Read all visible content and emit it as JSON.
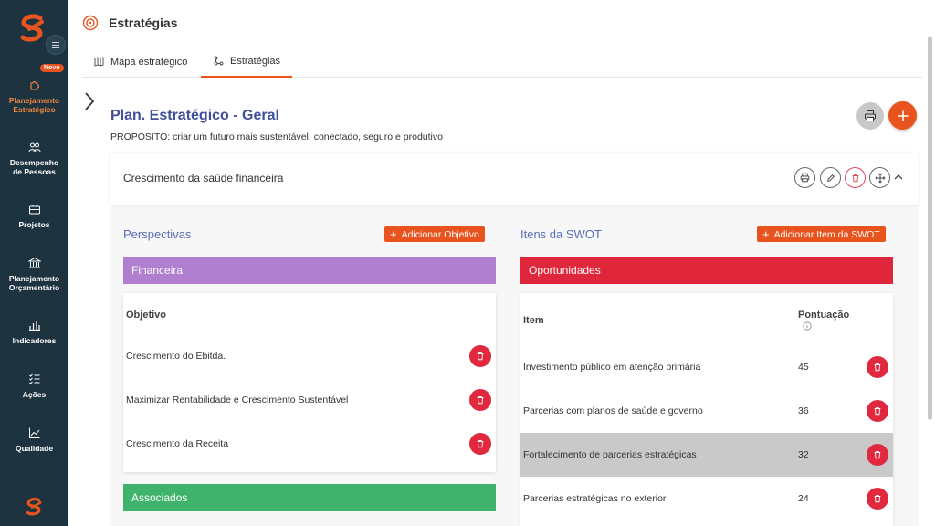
{
  "sidebar": {
    "badge": "Novo",
    "items": [
      {
        "line1": "Planejamento",
        "line2": "Estratégico",
        "icon": "puzzle-icon"
      },
      {
        "line1": "Desempenho",
        "line2": "de Pessoas",
        "icon": "people-icon"
      },
      {
        "line1": "Projetos",
        "line2": "",
        "icon": "briefcase-icon"
      },
      {
        "line1": "Planejamento",
        "line2": "Orçamentário",
        "icon": "bank-icon"
      },
      {
        "line1": "Indicadores",
        "line2": "",
        "icon": "bar-chart-icon"
      },
      {
        "line1": "Ações",
        "line2": "",
        "icon": "checklist-icon"
      },
      {
        "line1": "Qualidade",
        "line2": "",
        "icon": "line-chart-icon"
      }
    ],
    "accent": "#f0883e"
  },
  "header": {
    "title": "Estratégias",
    "tabs": [
      {
        "label": "Mapa estratégico",
        "icon": "map-icon"
      },
      {
        "label": "Estratégias",
        "icon": "hierarchy-icon"
      }
    ]
  },
  "plan": {
    "title": "Plan. Estratégico - Geral",
    "purpose": "PROPÓSITO: criar um futuro mais sustentável, conectado, seguro e produtivo"
  },
  "strategy": {
    "name": "Crescimento da saúde financeira"
  },
  "perspectives": {
    "title": "Perspectivas",
    "add_label": "Adicionar Objetivo",
    "groups": [
      {
        "name": "Financeira",
        "color": "#b07fcf"
      },
      {
        "name": "Associados",
        "color": "#3fb36b"
      }
    ],
    "column_header": "Objetivo",
    "rows": [
      "Crescimento do Ebitda.",
      "Maximizar Rentabilidade e Crescimento Sustentável",
      "Crescimento da Receita"
    ]
  },
  "swot": {
    "title": "Itens da SWOT",
    "add_label": "Adicionar Item da SWOT",
    "group": {
      "name": "Oportunidades",
      "color": "#e0263a"
    },
    "col_item": "Item",
    "col_score": "Pontuação",
    "rows": [
      {
        "item": "Investimento público em atenção primária",
        "score": "45"
      },
      {
        "item": "Parcerias com planos de saúde e governo",
        "score": "36"
      },
      {
        "item": "Fortalecimento de parcerias estratégicas",
        "score": "32"
      },
      {
        "item": "Parcerias estratégicas no exterior",
        "score": "24"
      }
    ]
  },
  "colors": {
    "brand": "#e8531e",
    "sidebar_bg": "#1e3340",
    "title_blue": "#3f4e9c",
    "danger": "#e0293f"
  }
}
